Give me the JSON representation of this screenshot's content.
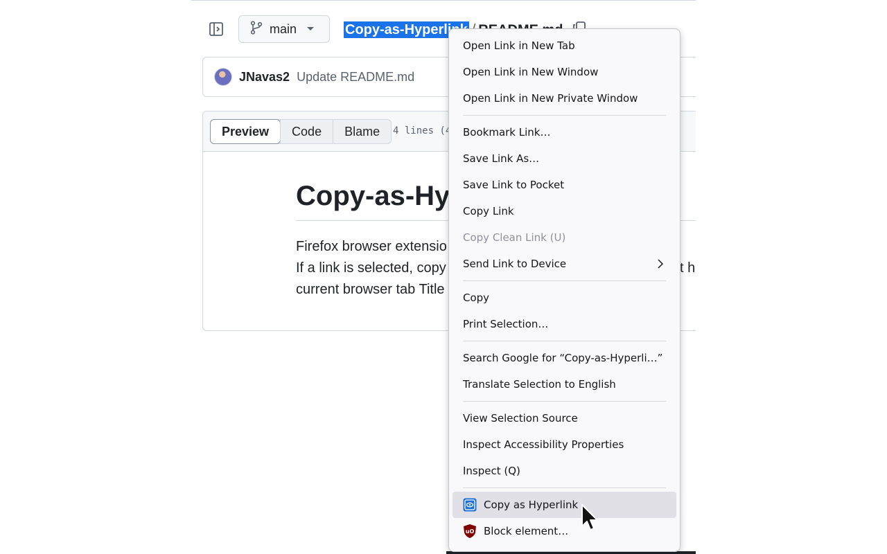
{
  "header": {
    "branch_label": "main",
    "repo_name": "Copy-as-Hyperlink",
    "separator": "/",
    "file_name": "README.md"
  },
  "commit": {
    "author": "JNavas2",
    "message": "Update README.md"
  },
  "file_view": {
    "tabs": [
      "Preview",
      "Code",
      "Blame"
    ],
    "active_tab": "Preview",
    "lines_info": "4 lines (4"
  },
  "readme": {
    "title": "Copy-as-Hy",
    "line1": "Firefox browser extensio",
    "line2": "If a link is selected, copy",
    "line2_tail": "xt h",
    "line3": "current browser tab Title"
  },
  "context_menu": {
    "items": [
      {
        "label": "Open Link in New Tab"
      },
      {
        "label": "Open Link in New Window"
      },
      {
        "label": "Open Link in New Private Window"
      },
      {
        "label": "Bookmark Link…"
      },
      {
        "label": "Save Link As…"
      },
      {
        "label": "Save Link to Pocket"
      },
      {
        "label": "Copy Link"
      },
      {
        "label": "Copy Clean Link (U)",
        "disabled": true
      },
      {
        "label": "Send Link to Device",
        "submenu": true
      },
      {
        "label": "Copy"
      },
      {
        "label": "Print Selection…"
      },
      {
        "label": "Search Google for “Copy-as-Hyperli…”"
      },
      {
        "label": "Translate Selection to English"
      },
      {
        "label": "View Selection Source"
      },
      {
        "label": "Inspect Accessibility Properties"
      },
      {
        "label": "Inspect (Q)"
      },
      {
        "label": "Copy as Hyperlink",
        "icon": "copy-as-hyperlink-extension-icon",
        "highlighted": true
      },
      {
        "label": "Block element…",
        "icon": "ublock-origin-icon"
      }
    ]
  },
  "colors": {
    "selection_highlight": "#1a73e8",
    "menu_background": "#f9f9fb",
    "menu_hover": "#e0e0e6",
    "disabled_text": "#8f8f9d"
  }
}
